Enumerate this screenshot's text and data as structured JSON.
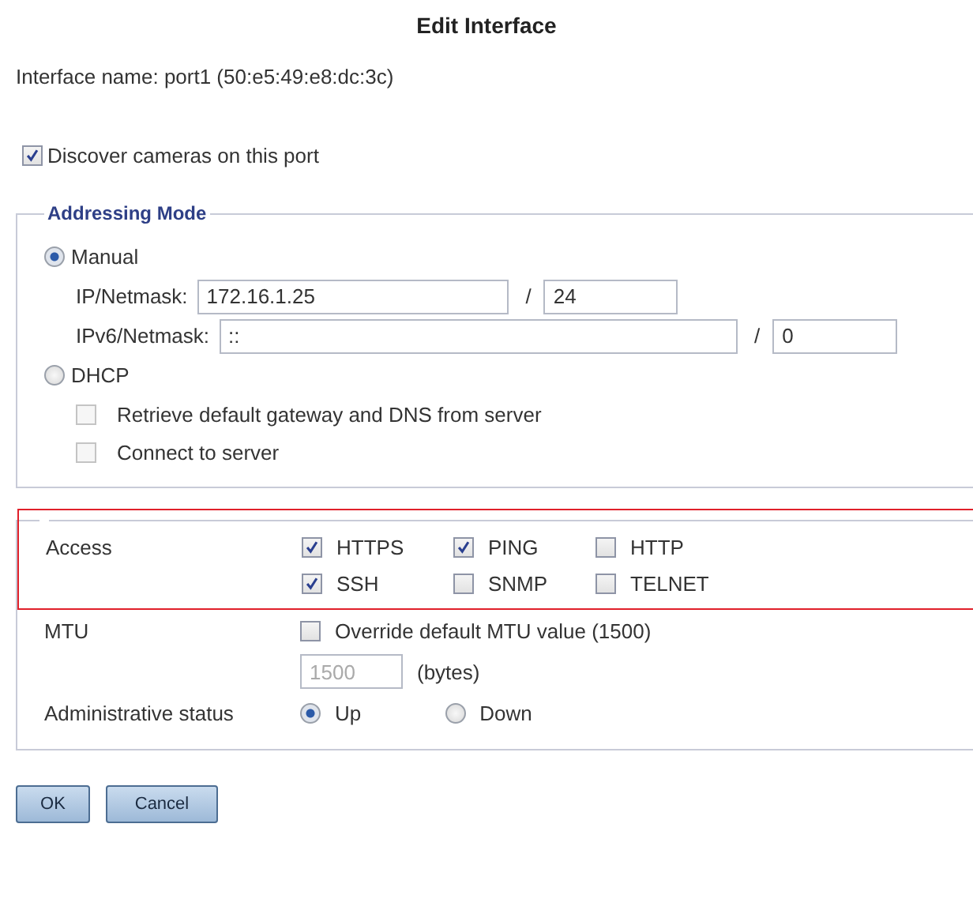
{
  "title": "Edit Interface",
  "interface_name": "Interface name: port1 (50:e5:49:e8:dc:3c)",
  "discover": {
    "label": "Discover cameras on this port",
    "checked": true
  },
  "addressing": {
    "legend": "Addressing Mode",
    "modes": [
      {
        "label": "Manual",
        "selected": true
      },
      {
        "label": "DHCP",
        "selected": false
      }
    ],
    "ipv4": {
      "label": "IP/Netmask:",
      "value": "172.16.1.25",
      "separator": "/",
      "prefix": "24"
    },
    "ipv6": {
      "label": "IPv6/Netmask:",
      "value": "::",
      "separator": "/",
      "prefix": "0"
    },
    "dhcp_options": [
      {
        "label": "Retrieve default gateway and DNS from server",
        "checked": false
      },
      {
        "label": "Connect to server",
        "checked": false
      }
    ]
  },
  "access": {
    "label": "Access",
    "highlighted": true,
    "options": [
      {
        "label": "HTTPS",
        "checked": true
      },
      {
        "label": "PING",
        "checked": true
      },
      {
        "label": "HTTP",
        "checked": false
      },
      {
        "label": "SSH",
        "checked": true
      },
      {
        "label": "SNMP",
        "checked": false
      },
      {
        "label": "TELNET",
        "checked": false
      }
    ]
  },
  "mtu": {
    "label": "MTU",
    "override": {
      "label": "Override default MTU value (1500)",
      "checked": false
    },
    "value": "1500",
    "disabled": true,
    "unit": "(bytes)"
  },
  "admin_status": {
    "label": "Administrative status",
    "options": [
      {
        "label": "Up",
        "selected": true
      },
      {
        "label": "Down",
        "selected": false
      }
    ]
  },
  "buttons": [
    "OK",
    "Cancel"
  ]
}
